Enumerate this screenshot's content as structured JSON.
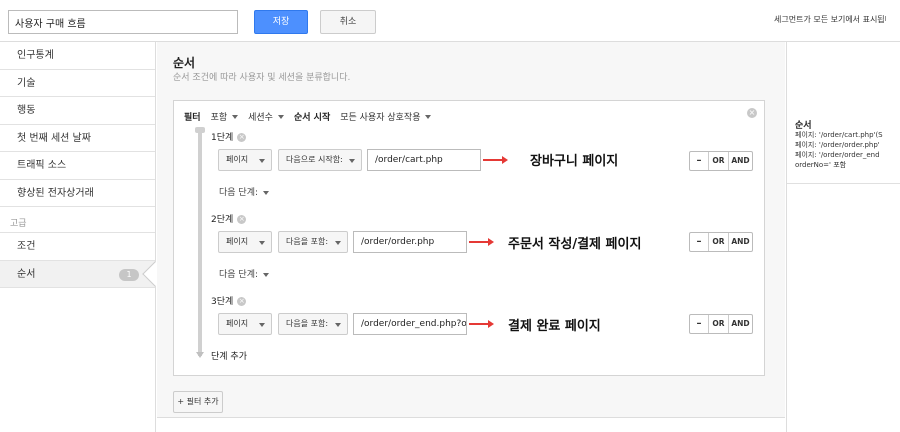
{
  "header": {
    "segment_name": "사용자 구매 흐름",
    "save_label": "저장",
    "cancel_label": "취소",
    "note": "세그먼트가 모든 보기에서 표시됩니다"
  },
  "sidebar": {
    "items": [
      {
        "label": "인구통계"
      },
      {
        "label": "기술"
      },
      {
        "label": "행동"
      },
      {
        "label": "첫 번째 세션 날짜"
      },
      {
        "label": "트래픽 소스"
      },
      {
        "label": "향상된 전자상거래"
      }
    ],
    "advanced_header": "고급",
    "advanced_items": [
      {
        "label": "조건",
        "badge": ""
      },
      {
        "label": "순서",
        "badge": "1"
      }
    ]
  },
  "main": {
    "title": "순서",
    "description": "순서 조건에 따라 사용자 및 세션을 분류합니다.",
    "filter": {
      "label": "필터",
      "include": "포함",
      "scope": "세션수",
      "sequence_start_label": "순서 시작",
      "sequence_start_value": "모든 사용자 상호작용"
    },
    "steps": [
      {
        "label": "1단계",
        "dimension": "페이지",
        "operator": "다음으로 시작함:",
        "value": "/order/cart.php",
        "annotation": "장바구니 페이지"
      },
      {
        "label": "2단계",
        "dimension": "페이지",
        "operator": "다음을 포함:",
        "value": "/order/order.php",
        "annotation": "주문서 작성/결제 페이지"
      },
      {
        "label": "3단계",
        "dimension": "페이지",
        "operator": "다음을 포함:",
        "value": "/order/order_end.php?o",
        "annotation": "결제 완료 페이지"
      }
    ],
    "next_step_label": "다음 단계:",
    "add_step_label": "단계 추가",
    "logic": {
      "minus": "–",
      "or": "OR",
      "and": "AND"
    },
    "add_filter_label": "+ 필터 추가"
  },
  "summary": {
    "title": "순서",
    "lines": [
      "페이지: '/order/cart.php'(S",
      "페이지: '/order/order.php'",
      "페이지: '/order/order_end",
      "orderNo=' 포함"
    ]
  }
}
